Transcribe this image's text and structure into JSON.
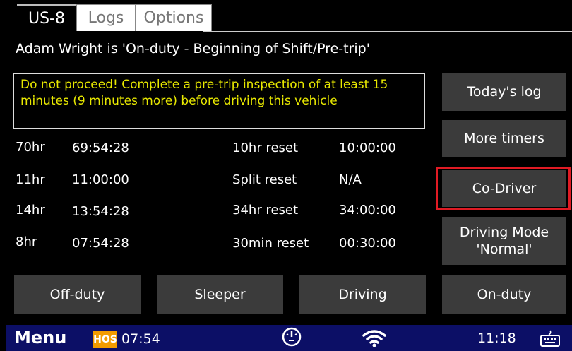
{
  "tabs": {
    "active": "US-8",
    "logs": "Logs",
    "options": "Options"
  },
  "status_line": "Adam Wright is 'On-duty - Beginning of Shift/Pre-trip'",
  "warning": "Do not proceed! Complete a pre-trip inspection of at least 15 minutes (9 minutes more) before driving this vehicle",
  "timers_left": [
    {
      "label": "70hr",
      "value": "69:54:28"
    },
    {
      "label": "11hr",
      "value": "11:00:00"
    },
    {
      "label": "14hr",
      "value": "13:54:28"
    },
    {
      "label": "8hr",
      "value": "07:54:28"
    }
  ],
  "timers_right": [
    {
      "label": "10hr reset",
      "value": "10:00:00"
    },
    {
      "label": "Split reset",
      "value": "N/A"
    },
    {
      "label": "34hr reset",
      "value": "34:00:00"
    },
    {
      "label": "30min reset",
      "value": "00:30:00"
    }
  ],
  "right_buttons": {
    "todays_log": "Today's log",
    "more_timers": "More timers",
    "co_driver": "Co-Driver",
    "driving_mode_line1": "Driving Mode",
    "driving_mode_line2": "'Normal'"
  },
  "duty_buttons": {
    "off_duty": "Off-duty",
    "sleeper": "Sleeper",
    "driving": "Driving",
    "on_duty": "On-duty"
  },
  "taskbar": {
    "menu": "Menu",
    "hos_badge": "HOS",
    "hos_time": "07:54",
    "clock": "11:18"
  },
  "colors": {
    "warning_text": "#e8e800",
    "highlight_border": "#e01b24",
    "taskbar_bg": "#0c0f66",
    "hos_badge_bg": "#f39b00",
    "button_bg": "#3b3b3b"
  },
  "icons": [
    "gauge-icon",
    "wifi-icon",
    "keyboard-icon"
  ]
}
